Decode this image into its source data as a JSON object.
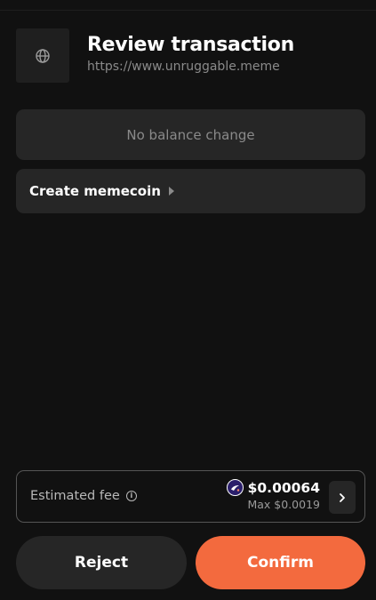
{
  "header": {
    "title": "Review transaction",
    "url": "https://www.unruggable.meme",
    "site_icon": "globe-icon"
  },
  "balance": {
    "text": "No balance change"
  },
  "action": {
    "label": "Create memecoin",
    "expand_icon": "caret-right-icon"
  },
  "fee": {
    "label": "Estimated fee",
    "info_icon": "info-icon",
    "token_icon": "starknet-token-icon",
    "amount": "$0.00064",
    "max": "Max $0.0019",
    "details_icon": "chevron-right-icon"
  },
  "buttons": {
    "reject": "Reject",
    "confirm": "Confirm"
  },
  "colors": {
    "background": "#111111",
    "card": "#262626",
    "accent": "#f36a3e",
    "muted_text": "#8a8a8a"
  }
}
